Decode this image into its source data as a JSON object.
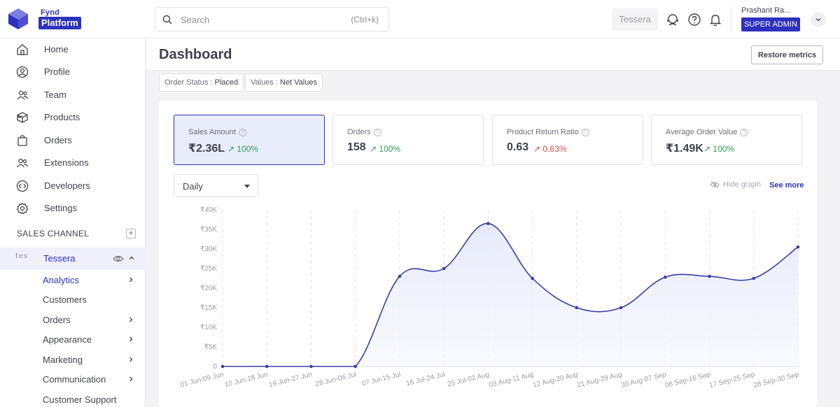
{
  "brand": {
    "line1": "Fynd",
    "line2": "Platform"
  },
  "search": {
    "placeholder": "Search",
    "shortcut": "(Ctrl+k)"
  },
  "header": {
    "context": "Tessera",
    "user_name": "Prashant Ra...",
    "role": "SUPER ADMIN"
  },
  "sidebar": {
    "items": [
      {
        "label": "Home",
        "icon": "home-icon"
      },
      {
        "label": "Profile",
        "icon": "user-icon"
      },
      {
        "label": "Team",
        "icon": "team-icon"
      },
      {
        "label": "Products",
        "icon": "box-icon"
      },
      {
        "label": "Orders",
        "icon": "bag-icon"
      },
      {
        "label": "Extensions",
        "icon": "extensions-icon"
      },
      {
        "label": "Developers",
        "icon": "developers-icon"
      },
      {
        "label": "Settings",
        "icon": "gear-icon"
      }
    ],
    "section_label": "SALES CHANNEL",
    "channel": {
      "thumb": "tes",
      "label": "Tessera"
    },
    "sub_items": [
      {
        "label": "Analytics"
      },
      {
        "label": "Customers"
      },
      {
        "label": "Orders"
      },
      {
        "label": "Appearance"
      },
      {
        "label": "Marketing"
      },
      {
        "label": "Communication"
      },
      {
        "label": "Customer Support"
      }
    ]
  },
  "page": {
    "title": "Dashboard",
    "restore_label": "Restore metrics"
  },
  "filters": [
    {
      "key": "Order Status : ",
      "value": "Placed"
    },
    {
      "key": "Values : ",
      "value": "Net Values"
    }
  ],
  "metrics": [
    {
      "label": "Sales Amount",
      "value": "₹2.36L",
      "delta": "100%",
      "trend": "up",
      "tone": "green"
    },
    {
      "label": "Orders",
      "value": "158",
      "delta": "100%",
      "trend": "up",
      "tone": "green"
    },
    {
      "label": "Product Return Ratio",
      "value": "0.63",
      "delta": "0.63%",
      "trend": "up",
      "tone": "red"
    },
    {
      "label": "Average Order Value",
      "value": "₹1.49K",
      "delta": "100%",
      "trend": "up",
      "tone": "green"
    }
  ],
  "chart_controls": {
    "granularity": "Daily",
    "hide_graph": "Hide graph",
    "see_more": "See more"
  },
  "colors": {
    "accent": "#2e31be",
    "line": "#3b3fa5",
    "fill": "#e6e9fb",
    "positive": "#2a9d52",
    "negative": "#d84b4b"
  },
  "chart_data": {
    "type": "area",
    "categories": [
      "01 Jun-09 Jun",
      "10 Jun-18 Jun",
      "19 Jun-27 Jun",
      "28 Jun-06 Jul",
      "07 Jul-15 Jul",
      "16 Jul-24 Jul",
      "25 Jul-02 Aug",
      "03 Aug-11 Aug",
      "12 Aug-20 Aug",
      "21 Aug-29 Aug",
      "30 Aug-07 Sep",
      "08 Sep-16 Sep",
      "17 Sep-25 Sep",
      "28 Sep-30 Sep"
    ],
    "values": [
      0,
      0,
      0,
      0,
      23000,
      25000,
      36500,
      22500,
      15000,
      15000,
      22800,
      23000,
      22500,
      30500
    ],
    "y_ticks": [
      "0",
      "₹5K",
      "₹10K",
      "₹15K",
      "₹20K",
      "₹25K",
      "₹30K",
      "₹35K",
      "₹40K"
    ],
    "ylim": [
      0,
      40000
    ],
    "grid": "vertical-dashed"
  }
}
